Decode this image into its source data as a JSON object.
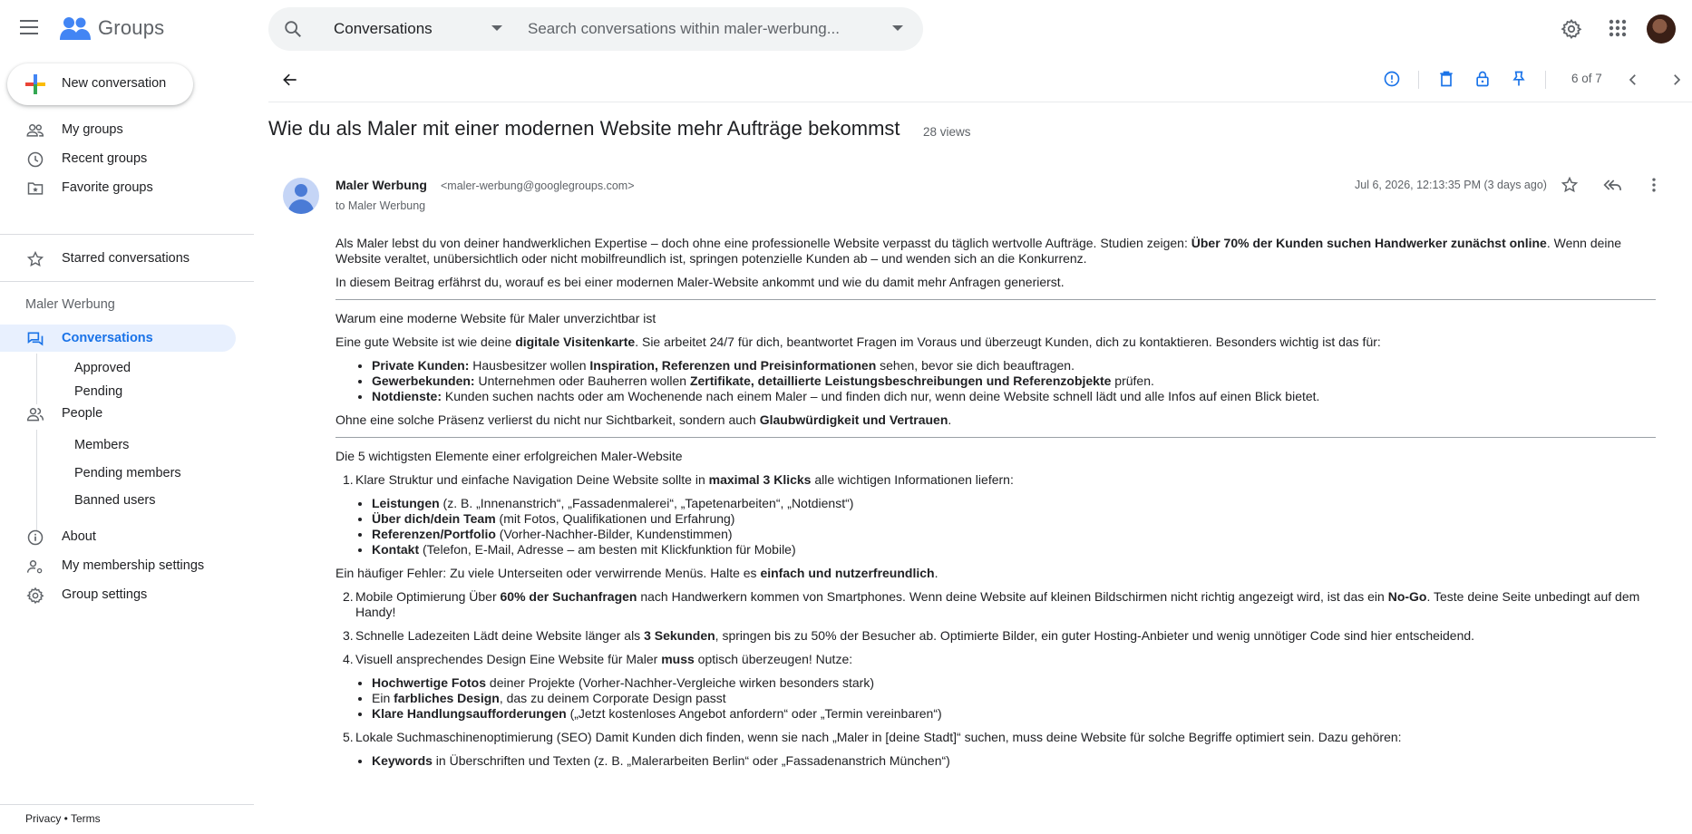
{
  "app": {
    "name": "Groups"
  },
  "search": {
    "scope": "Conversations",
    "placeholder": "Search conversations within maler-werbung..."
  },
  "sidebar": {
    "new_conversation": "New conversation",
    "items": [
      {
        "label": "My groups",
        "icon": "people-icon"
      },
      {
        "label": "Recent groups",
        "icon": "clock-icon"
      },
      {
        "label": "Favorite groups",
        "icon": "star-folder-icon"
      }
    ],
    "starred": "Starred conversations",
    "group_name": "Maler Werbung",
    "conversations": "Conversations",
    "approved": "Approved",
    "pending": "Pending",
    "people": "People",
    "members": "Members",
    "pending_members": "Pending members",
    "banned_users": "Banned users",
    "about": "About",
    "membership_settings": "My membership settings",
    "group_settings": "Group settings",
    "footer": {
      "privacy": "Privacy",
      "sep": " • ",
      "terms": "Terms"
    }
  },
  "toolbar": {
    "pager": "6 of 7"
  },
  "thread": {
    "subject": "Wie du als Maler mit einer modernen Website mehr Aufträge bekommst",
    "views": "28 views"
  },
  "message": {
    "sender": "Maler Werbung",
    "email": "<maler-werbung@googlegroups.com>",
    "to": "to Maler Werbung",
    "date": "Jul 6, 2026, 12:13:35 PM (3 days ago)"
  },
  "body": {
    "p1a": "Als Maler lebst du von deiner handwerklichen Expertise – doch ohne eine professionelle Website verpasst du täglich wertvolle Aufträge. Studien zeigen: ",
    "p1b": "Über 70% der Kunden suchen Handwerker zunächst online",
    "p1c": ". Wenn deine Website veraltet, unübersichtlich oder nicht mobilfreundlich ist, springen potenzielle Kunden ab – und wenden sich an die Konkurrenz.",
    "p2": "In diesem Beitrag erfährst du, worauf es bei einer modernen Maler-Website ankommt und wie du damit mehr Anfragen generierst.",
    "h1": "Warum eine moderne Website für Maler unverzichtbar ist",
    "p3a": "Eine gute Website ist wie deine ",
    "p3b": "digitale Visitenkarte",
    "p3c": ". Sie arbeitet 24/7 für dich, beantwortet Fragen im Voraus und überzeugt Kunden, dich zu kontaktieren. Besonders wichtig ist das für:",
    "l1a": "Private Kunden:",
    "l1b": " Hausbesitzer wollen ",
    "l1c": "Inspiration, Referenzen und Preisinformationen",
    "l1d": " sehen, bevor sie dich beauftragen.",
    "l2a": "Gewerbekunden:",
    "l2b": " Unternehmen oder Bauherren wollen ",
    "l2c": "Zertifikate, detaillierte Leistungsbeschreibungen und Referenzobjekte",
    "l2d": " prüfen.",
    "l3a": "Notdienste:",
    "l3b": " Kunden suchen nachts oder am Wochenende nach einem Maler – und finden dich nur, wenn deine Website schnell lädt und alle Infos auf einen Blick bietet.",
    "p4a": "Ohne eine solche Präsenz verlierst du nicht nur Sichtbarkeit, sondern auch ",
    "p4b": "Glaubwürdigkeit und Vertrauen",
    "p4c": ".",
    "h2": "Die 5 wichtigsten Elemente einer erfolgreichen Maler-Website",
    "n1a": "Klare Struktur und einfache Navigation Deine Website sollte in ",
    "n1b": "maximal 3 Klicks",
    "n1c": " alle wichtigen Informationen liefern:",
    "s1a": "Leistungen",
    "s1b": " (z. B. „Innenanstrich“, „Fassadenmalerei“, „Tapetenarbeiten“, „Notdienst“)",
    "s2a": "Über dich/dein Team",
    "s2b": " (mit Fotos, Qualifikationen und Erfahrung)",
    "s3a": "Referenzen/Portfolio",
    "s3b": " (Vorher-Nachher-Bilder, Kundenstimmen)",
    "s4a": "Kontakt",
    "s4b": " (Telefon, E-Mail, Adresse – am besten mit Klickfunktion für Mobile)",
    "p5a": "Ein häufiger Fehler: Zu viele Unterseiten oder verwirrende Menüs. Halte es ",
    "p5b": "einfach und nutzerfreundlich",
    "p5c": ".",
    "n2a": "Mobile Optimierung Über ",
    "n2b": "60% der Suchanfragen",
    "n2c": " nach Handwerkern kommen von Smartphones. Wenn deine Website auf kleinen Bildschirmen nicht richtig angezeigt wird, ist das ein ",
    "n2d": "No-Go",
    "n2e": ". Teste deine Seite unbedingt auf dem Handy!",
    "n3a": "Schnelle Ladezeiten Lädt deine Website länger als ",
    "n3b": "3 Sekunden",
    "n3c": ", springen bis zu 50% der Besucher ab. Optimierte Bilder, ein guter Hosting-Anbieter und wenig unnötiger Code sind hier entscheidend.",
    "n4a": "Visuell ansprechendes Design Eine Website für Maler ",
    "n4b": "muss",
    "n4c": " optisch überzeugen! Nutze:",
    "d1a": "Hochwertige Fotos",
    "d1b": " deiner Projekte (Vorher-Nachher-Vergleiche wirken besonders stark)",
    "d2a": "Ein ",
    "d2b": "farbliches Design",
    "d2c": ", das zu deinem Corporate Design passt",
    "d3a": "Klare Handlungsaufforderungen",
    "d3b": " („Jetzt kostenloses Angebot anfordern“ oder „Termin vereinbaren“)",
    "n5": "Lokale Suchmaschinenoptimierung (SEO) Damit Kunden dich finden, wenn sie nach „Maler in [deine Stadt]“ suchen, muss deine Website für solche Begriffe optimiert sein. Dazu gehören:",
    "k1a": "Keywords",
    "k1b": " in Überschriften und Texten (z. B. „Malerarbeiten Berlin“ oder „Fassadenanstrich München“)"
  },
  "colors": {
    "accent": "#1a73e8",
    "active_bg": "#e8f0fe",
    "search_bg": "#f1f3f4"
  }
}
